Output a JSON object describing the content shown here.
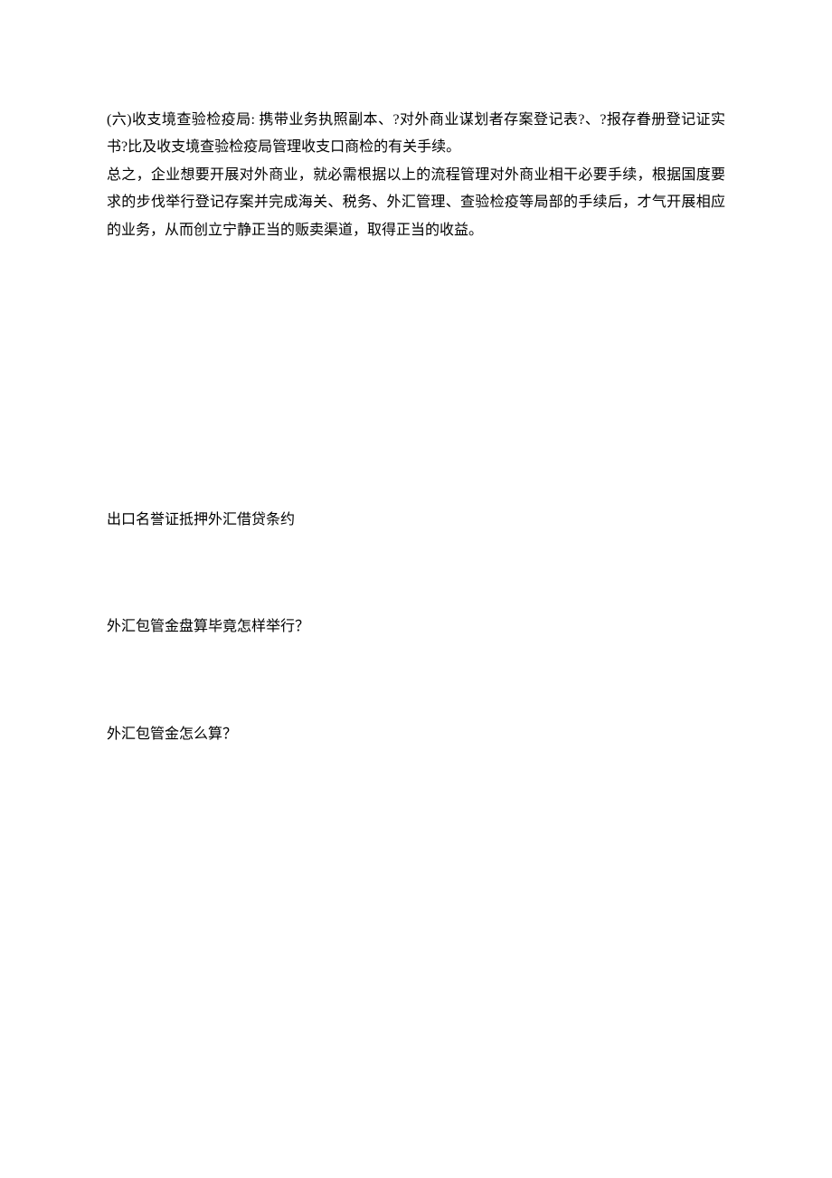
{
  "paragraphs": {
    "p1": "(六)收支境查验检疫局: 携带业务执照副本、?对外商业谋划者存案登记表?、?报存眷册登记证实书?比及收支境查验检疫局管理收支口商检的有关手续。",
    "p2": "总之，企业想要开展对外商业，就必需根据以上的流程管理对外商业相干必要手续，根据国度要求的步伐举行登记存案并完成海关、税务、外汇管理、查验检疫等局部的手续后，才气开展相应的业务，从而创立宁静正当的贩卖渠道，取得正当的收益。"
  },
  "lines": {
    "l1": "出口名誉证抵押外汇借贷条约",
    "l2": "外汇包管金盘算毕竟怎样举行？",
    "l3": "外汇包管金怎么算？"
  }
}
